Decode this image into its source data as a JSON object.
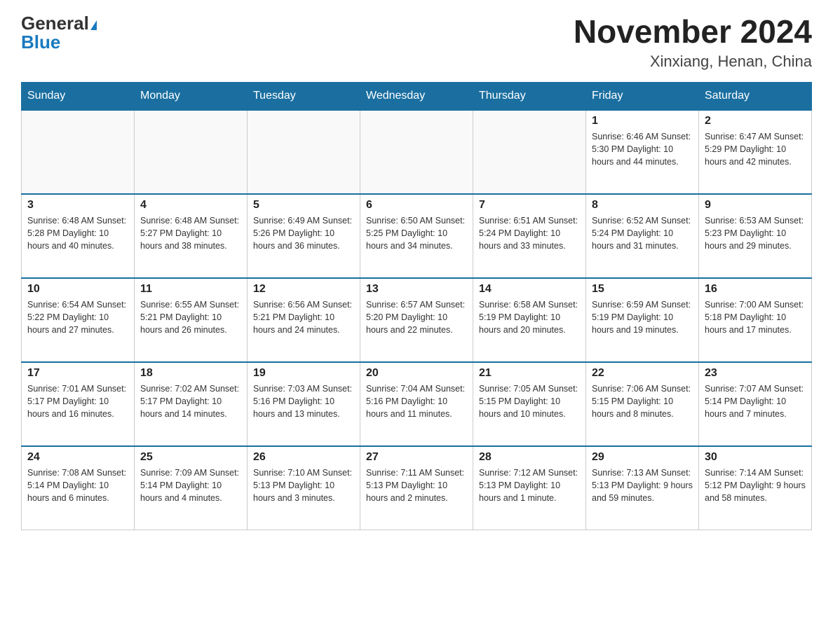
{
  "header": {
    "logo_general": "General",
    "logo_blue": "Blue",
    "month_title": "November 2024",
    "location": "Xinxiang, Henan, China"
  },
  "weekdays": [
    "Sunday",
    "Monday",
    "Tuesday",
    "Wednesday",
    "Thursday",
    "Friday",
    "Saturday"
  ],
  "weeks": [
    [
      {
        "day": "",
        "info": ""
      },
      {
        "day": "",
        "info": ""
      },
      {
        "day": "",
        "info": ""
      },
      {
        "day": "",
        "info": ""
      },
      {
        "day": "",
        "info": ""
      },
      {
        "day": "1",
        "info": "Sunrise: 6:46 AM\nSunset: 5:30 PM\nDaylight: 10 hours\nand 44 minutes."
      },
      {
        "day": "2",
        "info": "Sunrise: 6:47 AM\nSunset: 5:29 PM\nDaylight: 10 hours\nand 42 minutes."
      }
    ],
    [
      {
        "day": "3",
        "info": "Sunrise: 6:48 AM\nSunset: 5:28 PM\nDaylight: 10 hours\nand 40 minutes."
      },
      {
        "day": "4",
        "info": "Sunrise: 6:48 AM\nSunset: 5:27 PM\nDaylight: 10 hours\nand 38 minutes."
      },
      {
        "day": "5",
        "info": "Sunrise: 6:49 AM\nSunset: 5:26 PM\nDaylight: 10 hours\nand 36 minutes."
      },
      {
        "day": "6",
        "info": "Sunrise: 6:50 AM\nSunset: 5:25 PM\nDaylight: 10 hours\nand 34 minutes."
      },
      {
        "day": "7",
        "info": "Sunrise: 6:51 AM\nSunset: 5:24 PM\nDaylight: 10 hours\nand 33 minutes."
      },
      {
        "day": "8",
        "info": "Sunrise: 6:52 AM\nSunset: 5:24 PM\nDaylight: 10 hours\nand 31 minutes."
      },
      {
        "day": "9",
        "info": "Sunrise: 6:53 AM\nSunset: 5:23 PM\nDaylight: 10 hours\nand 29 minutes."
      }
    ],
    [
      {
        "day": "10",
        "info": "Sunrise: 6:54 AM\nSunset: 5:22 PM\nDaylight: 10 hours\nand 27 minutes."
      },
      {
        "day": "11",
        "info": "Sunrise: 6:55 AM\nSunset: 5:21 PM\nDaylight: 10 hours\nand 26 minutes."
      },
      {
        "day": "12",
        "info": "Sunrise: 6:56 AM\nSunset: 5:21 PM\nDaylight: 10 hours\nand 24 minutes."
      },
      {
        "day": "13",
        "info": "Sunrise: 6:57 AM\nSunset: 5:20 PM\nDaylight: 10 hours\nand 22 minutes."
      },
      {
        "day": "14",
        "info": "Sunrise: 6:58 AM\nSunset: 5:19 PM\nDaylight: 10 hours\nand 20 minutes."
      },
      {
        "day": "15",
        "info": "Sunrise: 6:59 AM\nSunset: 5:19 PM\nDaylight: 10 hours\nand 19 minutes."
      },
      {
        "day": "16",
        "info": "Sunrise: 7:00 AM\nSunset: 5:18 PM\nDaylight: 10 hours\nand 17 minutes."
      }
    ],
    [
      {
        "day": "17",
        "info": "Sunrise: 7:01 AM\nSunset: 5:17 PM\nDaylight: 10 hours\nand 16 minutes."
      },
      {
        "day": "18",
        "info": "Sunrise: 7:02 AM\nSunset: 5:17 PM\nDaylight: 10 hours\nand 14 minutes."
      },
      {
        "day": "19",
        "info": "Sunrise: 7:03 AM\nSunset: 5:16 PM\nDaylight: 10 hours\nand 13 minutes."
      },
      {
        "day": "20",
        "info": "Sunrise: 7:04 AM\nSunset: 5:16 PM\nDaylight: 10 hours\nand 11 minutes."
      },
      {
        "day": "21",
        "info": "Sunrise: 7:05 AM\nSunset: 5:15 PM\nDaylight: 10 hours\nand 10 minutes."
      },
      {
        "day": "22",
        "info": "Sunrise: 7:06 AM\nSunset: 5:15 PM\nDaylight: 10 hours\nand 8 minutes."
      },
      {
        "day": "23",
        "info": "Sunrise: 7:07 AM\nSunset: 5:14 PM\nDaylight: 10 hours\nand 7 minutes."
      }
    ],
    [
      {
        "day": "24",
        "info": "Sunrise: 7:08 AM\nSunset: 5:14 PM\nDaylight: 10 hours\nand 6 minutes."
      },
      {
        "day": "25",
        "info": "Sunrise: 7:09 AM\nSunset: 5:14 PM\nDaylight: 10 hours\nand 4 minutes."
      },
      {
        "day": "26",
        "info": "Sunrise: 7:10 AM\nSunset: 5:13 PM\nDaylight: 10 hours\nand 3 minutes."
      },
      {
        "day": "27",
        "info": "Sunrise: 7:11 AM\nSunset: 5:13 PM\nDaylight: 10 hours\nand 2 minutes."
      },
      {
        "day": "28",
        "info": "Sunrise: 7:12 AM\nSunset: 5:13 PM\nDaylight: 10 hours\nand 1 minute."
      },
      {
        "day": "29",
        "info": "Sunrise: 7:13 AM\nSunset: 5:13 PM\nDaylight: 9 hours\nand 59 minutes."
      },
      {
        "day": "30",
        "info": "Sunrise: 7:14 AM\nSunset: 5:12 PM\nDaylight: 9 hours\nand 58 minutes."
      }
    ]
  ]
}
